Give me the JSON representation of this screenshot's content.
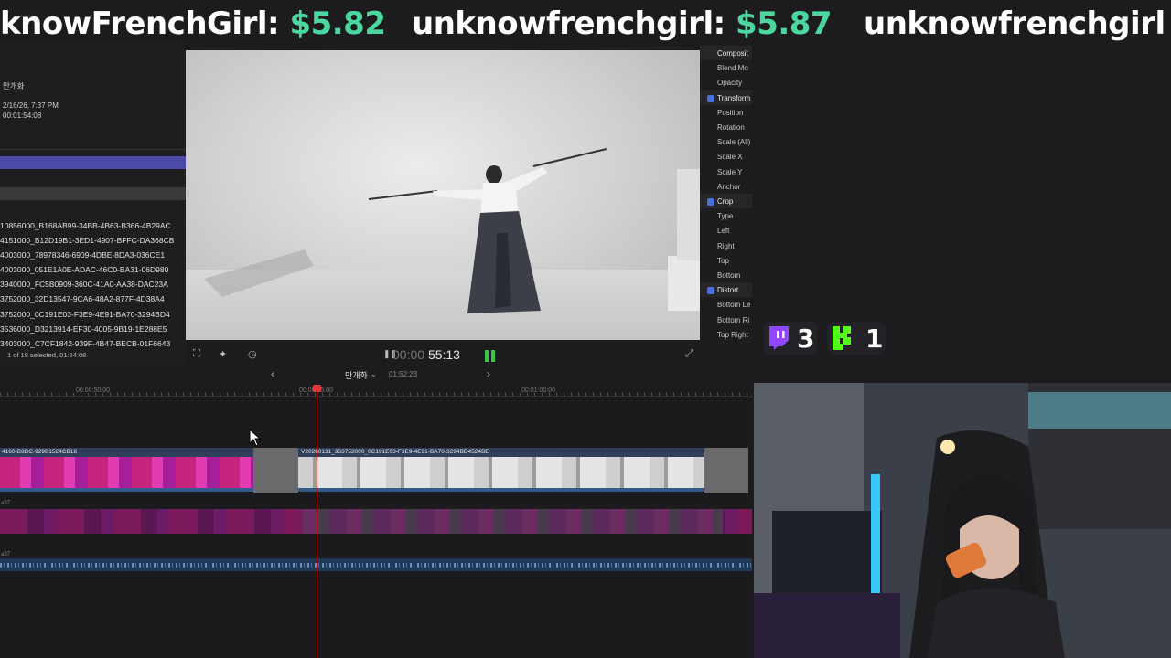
{
  "ticker": [
    {
      "name": "knowFrenchGirl:",
      "amount": "$5.82"
    },
    {
      "name": "unknowfrenchgirl:",
      "amount": "$5.87"
    },
    {
      "name": "unknowfrenchgirl",
      "amount": ""
    }
  ],
  "browser": {
    "event_name": "만개화",
    "date": "2/16/26, 7:37 PM",
    "duration": "00:01:54:08",
    "clips": [
      "10856000_B168AB99-34BB-4B63-B366-4B29AC",
      "4151000_B12D19B1-3ED1-4907-BFFC-DA368CB",
      "4003000_78978346-6909-4DBE-8DA3-036CE1",
      "4003000_051E1A0E-ADAC-46C0-BA31-06D980",
      "3940000_FC5B0909-360C-41A0-AA38-DAC23A",
      "3752000_32D13547-9CA6-48A2-877F-4D38A4",
      "3752000_0C191E03-F3E9-4E91-BA70-3294BD4",
      "3536000_D3213914-EF30-4005-9B19-1E288E5",
      "3403000_C7CF1842-939F-4B47-BECB-01F6643"
    ],
    "selection": "1 of 18 selected, 01:54:08"
  },
  "viewer": {
    "timecode_dim": "00:00",
    "timecode_bright": "55:13"
  },
  "inspector": {
    "rows": [
      {
        "label": "Composit",
        "head": true,
        "check": false
      },
      {
        "label": "Blend Mo",
        "head": false,
        "check": false
      },
      {
        "label": "Opacity",
        "head": false,
        "check": false
      },
      {
        "label": "Transform",
        "head": true,
        "check": true
      },
      {
        "label": "Position",
        "head": false,
        "check": false
      },
      {
        "label": "Rotation",
        "head": false,
        "check": false
      },
      {
        "label": "Scale (All)",
        "head": false,
        "check": false
      },
      {
        "label": "Scale X",
        "head": false,
        "check": false
      },
      {
        "label": "Scale Y",
        "head": false,
        "check": false
      },
      {
        "label": "Anchor",
        "head": false,
        "check": false
      },
      {
        "label": "Crop",
        "head": true,
        "check": true
      },
      {
        "label": "Type",
        "head": false,
        "check": false
      },
      {
        "label": "Left",
        "head": false,
        "check": false
      },
      {
        "label": "Right",
        "head": false,
        "check": false
      },
      {
        "label": "Top",
        "head": false,
        "check": false
      },
      {
        "label": "Bottom",
        "head": false,
        "check": false
      },
      {
        "label": "Distort",
        "head": true,
        "check": true
      },
      {
        "label": "Bottom Le",
        "head": false,
        "check": false
      },
      {
        "label": "Bottom Ri",
        "head": false,
        "check": false
      },
      {
        "label": "Top Right",
        "head": false,
        "check": false
      }
    ]
  },
  "timeline": {
    "project_name": "만개화",
    "project_duration": "01:52:23",
    "ruler_labels": [
      "00:00:50:00",
      "00:00:55:00",
      "00:01:00:00"
    ],
    "clip_a_title": "4160-B3DC-929B1524CB18",
    "clip_b_title": "V20260131_353752000_0C191E03-F3E9-4E91-BA70-3294BD4524BE",
    "track_label_1": "a37",
    "track_label_2": "a37"
  },
  "counters": {
    "twitch": "3",
    "kick": "1"
  },
  "colors": {
    "accent_green": "#4cd6a0",
    "twitch_purple": "#9146ff",
    "kick_green": "#53fc18",
    "playhead": "#e23a3a"
  }
}
